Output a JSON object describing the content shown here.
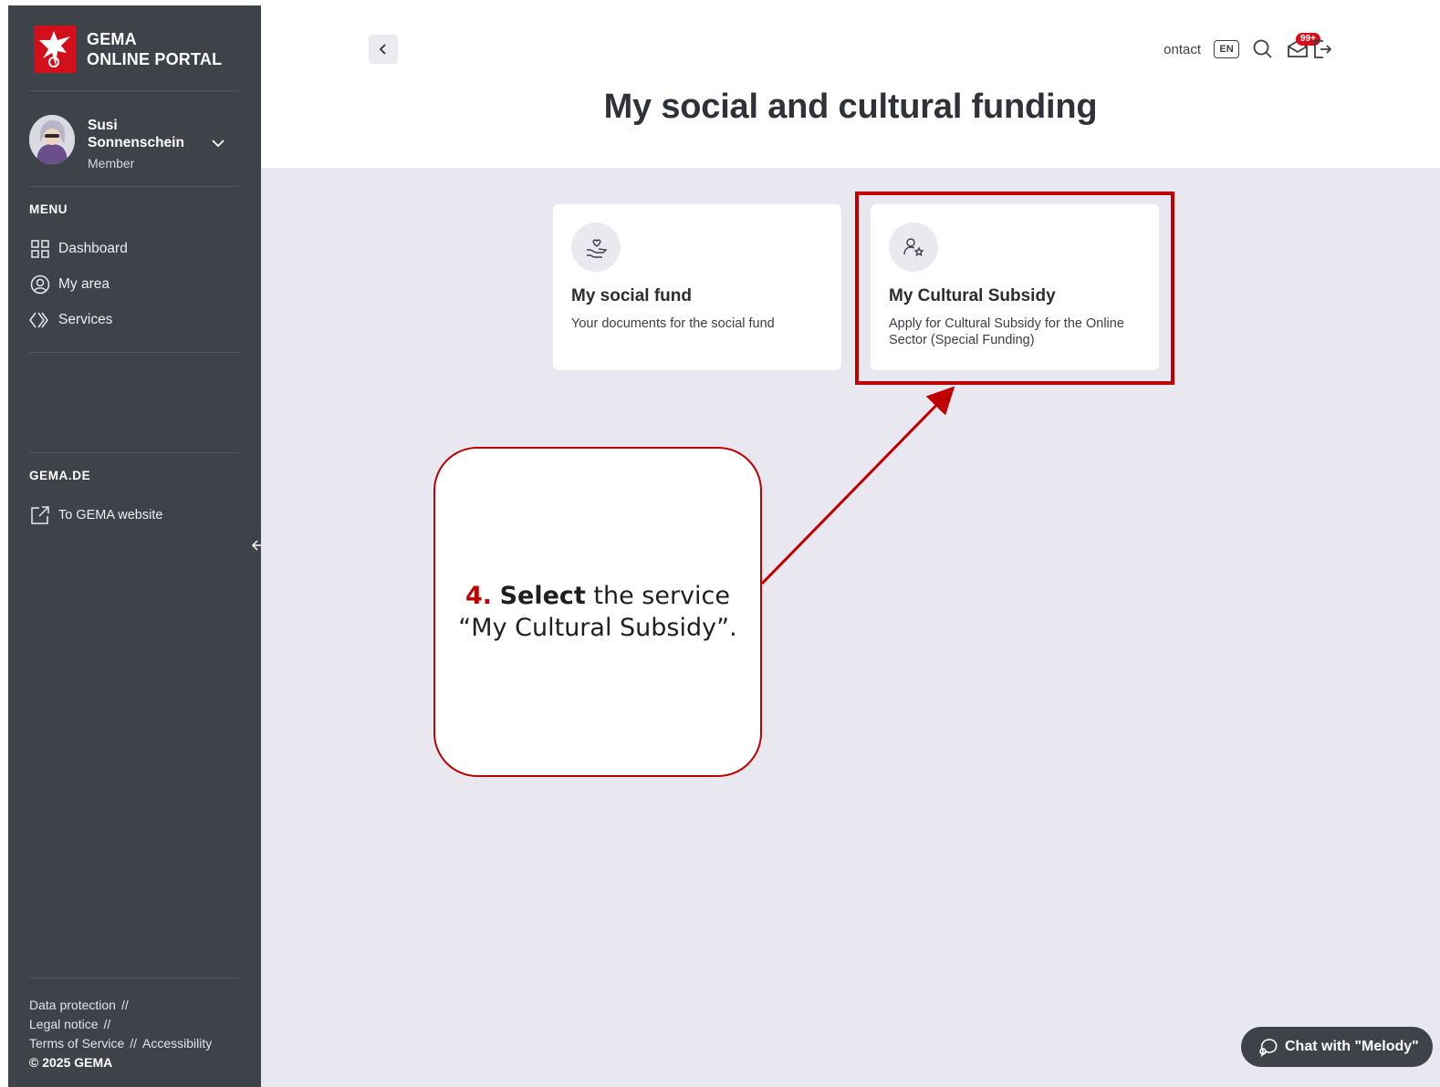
{
  "sidebar": {
    "brand_line1": "GEMA",
    "brand_line2": "ONLINE PORTAL",
    "user": {
      "first_name": "Susi",
      "last_name": "Sonnenschein",
      "role": "Member"
    },
    "menu_label": "MENU",
    "menu_items": [
      {
        "label": "Dashboard",
        "icon": "grid-icon"
      },
      {
        "label": "My area",
        "icon": "user-circle-icon"
      },
      {
        "label": "Services",
        "icon": "services-chevrons-icon"
      }
    ],
    "gema_label": "GEMA.DE",
    "gema_link": {
      "label": "To GEMA website",
      "icon": "external-link-icon"
    },
    "footer": {
      "data_protection": "Data protection",
      "legal_notice": "Legal notice",
      "terms": "Terms of Service",
      "accessibility": "Accessibility",
      "separator": "//",
      "copyright": "© 2025 GEMA"
    }
  },
  "header": {
    "contact": "Contact",
    "language": "EN",
    "notifications_badge": "99+"
  },
  "page": {
    "title": "My social and cultural funding"
  },
  "cards": [
    {
      "title": "My social fund",
      "description": "Your documents for the social fund",
      "icon": "hand-heart-icon"
    },
    {
      "title": "My Cultural Subsidy",
      "description": "Apply for Cultural Subsidy for the Online Sector (Special Funding)",
      "icon": "person-star-icon"
    }
  ],
  "callout": {
    "number": "4.",
    "bold": "Select",
    "rest_line1": " the service",
    "line2": "“My Cultural Subsidy”."
  },
  "chat": {
    "label": "Chat with \"Melody\""
  },
  "colors": {
    "sidebar_bg": "#3e4249",
    "content_bg": "#e9e7ef",
    "brand_red": "#d40f1c",
    "annotation_red": "#c00000"
  }
}
